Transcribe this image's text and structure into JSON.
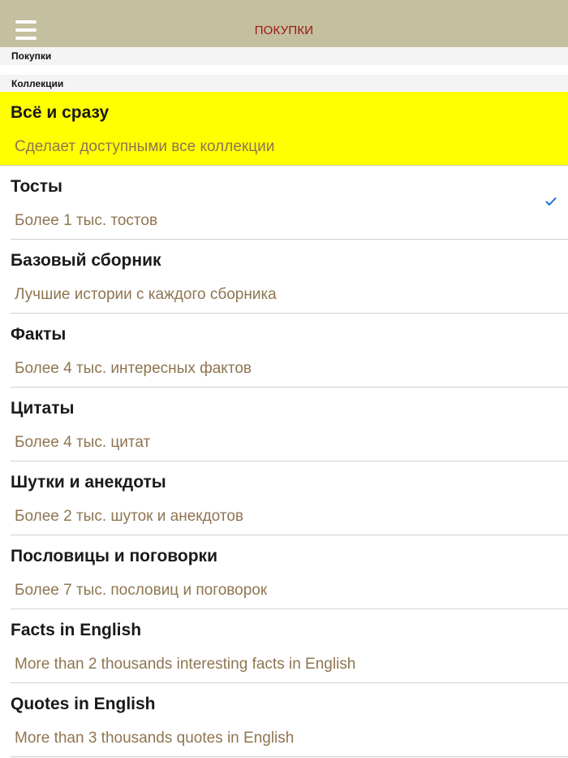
{
  "navbar": {
    "title": "ПОКУПКИ",
    "menu_icon": "hamburger-menu-icon",
    "accent_color": "#9a1414",
    "background_color": "#c4bf9e"
  },
  "sections": {
    "purchases_header": "Покупки",
    "collections_header": "Коллекции"
  },
  "items": [
    {
      "title": "Всё и сразу",
      "subtitle": "Сделает доступными все коллекции",
      "highlighted": true,
      "checked": false
    },
    {
      "title": "Тосты",
      "subtitle": "Более 1 тыс. тостов",
      "highlighted": false,
      "checked": true
    },
    {
      "title": "Базовый сборник",
      "subtitle": "Лучшие истории с каждого сборника",
      "highlighted": false,
      "checked": false
    },
    {
      "title": "Факты",
      "subtitle": "Более 4 тыс. интересных фактов",
      "highlighted": false,
      "checked": false
    },
    {
      "title": "Цитаты",
      "subtitle": "Более 4 тыс. цитат",
      "highlighted": false,
      "checked": false
    },
    {
      "title": "Шутки и анекдоты",
      "subtitle": "Более 2 тыс. шуток и анекдотов",
      "highlighted": false,
      "checked": false
    },
    {
      "title": "Пословицы и поговорки",
      "subtitle": "Более 7 тыс. пословиц и поговорок",
      "highlighted": false,
      "checked": false
    },
    {
      "title": "Facts in English",
      "subtitle": "More than 2 thousands interesting facts in English",
      "highlighted": false,
      "checked": false
    },
    {
      "title": "Quotes in English",
      "subtitle": "More than 3 thousands quotes in English",
      "highlighted": false,
      "checked": false
    }
  ],
  "colors": {
    "highlight": "#ffff00",
    "subtitle": "#8f7551",
    "checkmark": "#1a6fd6"
  }
}
